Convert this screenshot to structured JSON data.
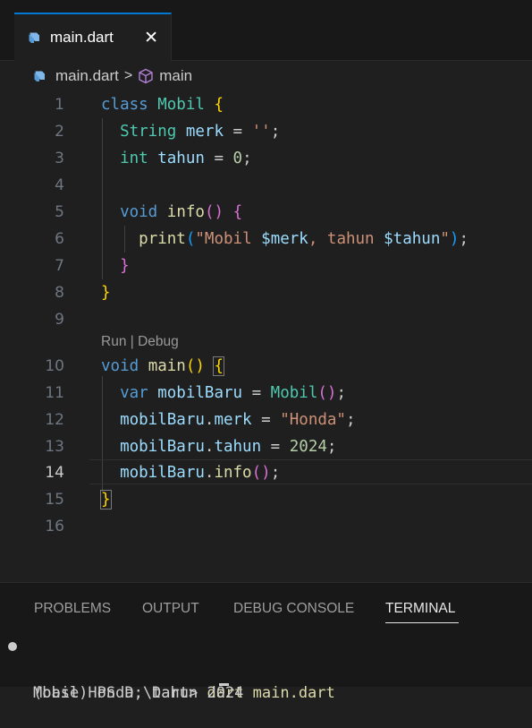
{
  "tab": {
    "filename": "main.dart",
    "close_glyph": "✕"
  },
  "breadcrumb": {
    "file": "main.dart",
    "separator": ">",
    "symbol": "main"
  },
  "codelens": {
    "run": "Run",
    "sep": " | ",
    "debug": "Debug"
  },
  "editor": {
    "active_line": 14,
    "line_numbers": [
      "1",
      "2",
      "3",
      "4",
      "5",
      "6",
      "7",
      "8",
      "9",
      "10",
      "11",
      "12",
      "13",
      "14",
      "15",
      "16"
    ],
    "lines": {
      "l1": {
        "kw": "class",
        "cls": "Mobil",
        "b": "{"
      },
      "l2": {
        "type": "String",
        "var": "merk",
        "eq": " = ",
        "str": "''",
        "semi": ";"
      },
      "l3": {
        "type": "int",
        "var": "tahun",
        "eq": " = ",
        "num": "0",
        "semi": ";"
      },
      "l5": {
        "kw": "void",
        "fn": "info",
        "parens": "()",
        "b": "{"
      },
      "l6": {
        "fn": "print",
        "open": "(",
        "str1": "\"Mobil ",
        "var1": "$merk",
        "str2": ", tahun ",
        "var2": "$tahun",
        "str3": "\"",
        "close": ")",
        "semi": ";"
      },
      "l7": {
        "b": "}"
      },
      "l8": {
        "b": "}"
      },
      "l10": {
        "kw": "void",
        "fn": "main",
        "parens": "()",
        "b": "{"
      },
      "l11": {
        "kw": "var",
        "var": "mobilBaru",
        "eq": " = ",
        "cls": "Mobil",
        "parens": "()",
        "semi": ";"
      },
      "l12": {
        "var1": "mobilBaru",
        "dot": ".",
        "var2": "merk",
        "eq": " = ",
        "str": "\"Honda\"",
        "semi": ";"
      },
      "l13": {
        "var1": "mobilBaru",
        "dot": ".",
        "var2": "tahun",
        "eq": " = ",
        "num": "2024",
        "semi": ";"
      },
      "l14": {
        "var": "mobilBaru",
        "dot": ".",
        "fn": "info",
        "parens": "()",
        "semi": ";"
      },
      "l15": {
        "b": "}"
      }
    }
  },
  "panel": {
    "tabs": [
      "PROBLEMS",
      "OUTPUT",
      "DEBUG CONSOLE",
      "TERMINAL"
    ],
    "active_tab": "TERMINAL"
  },
  "terminal": {
    "prompt": "(base) PS D:\\Dart> ",
    "command": "dart main.dart",
    "output": "Mobil Honda, tahun 2024"
  },
  "colors": {
    "keyword": "#569cd6",
    "class": "#4ec9b0",
    "function": "#dcdcaa",
    "variable": "#9cdcfe",
    "string": "#ce9178",
    "number": "#b5cea8",
    "bracket_1": "#ffd700",
    "bracket_2": "#da70d6",
    "bracket_3": "#179fff",
    "accent": "#0078d4"
  },
  "icons": {
    "dart": "dart-icon",
    "symbol": "cube-icon",
    "close": "close-icon"
  }
}
